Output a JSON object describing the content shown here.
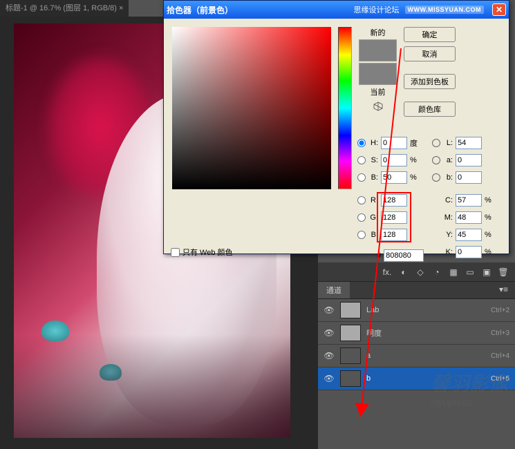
{
  "tab": {
    "title": "标题-1 @ 16.7% (图层 1, RGB/8) ×"
  },
  "dialog": {
    "title": "拾色器（前景色）",
    "brand": "思缘设计论坛",
    "url": "WWW.MISSYUAN.COM",
    "new_label": "新的",
    "current_label": "当前",
    "buttons": {
      "ok": "确定",
      "cancel": "取消",
      "add_swatch": "添加到色板",
      "libraries": "颜色库"
    },
    "web_only_label": "只有 Web 颜色",
    "fields": {
      "H": {
        "label": "H:",
        "value": "0",
        "unit": "度"
      },
      "S": {
        "label": "S:",
        "value": "0",
        "unit": "%"
      },
      "Bv": {
        "label": "B:",
        "value": "50",
        "unit": "%"
      },
      "R": {
        "label": "R:",
        "value": "128"
      },
      "G": {
        "label": "G:",
        "value": "128"
      },
      "B": {
        "label": "B:",
        "value": "128"
      },
      "L": {
        "label": "L:",
        "value": "54"
      },
      "a": {
        "label": "a:",
        "value": "0"
      },
      "b": {
        "label": "b:",
        "value": "0"
      },
      "C": {
        "label": "C:",
        "value": "57",
        "unit": "%"
      },
      "M": {
        "label": "M:",
        "value": "48",
        "unit": "%"
      },
      "Y": {
        "label": "Y:",
        "value": "45",
        "unit": "%"
      },
      "K": {
        "label": "K:",
        "value": "0",
        "unit": "%"
      },
      "hex": {
        "label": "#",
        "value": "808080"
      }
    }
  },
  "channels": {
    "tab": "通道",
    "rows": [
      {
        "name": "Lab",
        "shortcut": "Ctrl+2"
      },
      {
        "name": "明度",
        "shortcut": "Ctrl+3"
      },
      {
        "name": "a",
        "shortcut": "Ctrl+4"
      },
      {
        "name": "b",
        "shortcut": "Ctrl+5"
      }
    ]
  },
  "watermark": {
    "main": "馨羽影像",
    "sub": "inyuphoto"
  }
}
